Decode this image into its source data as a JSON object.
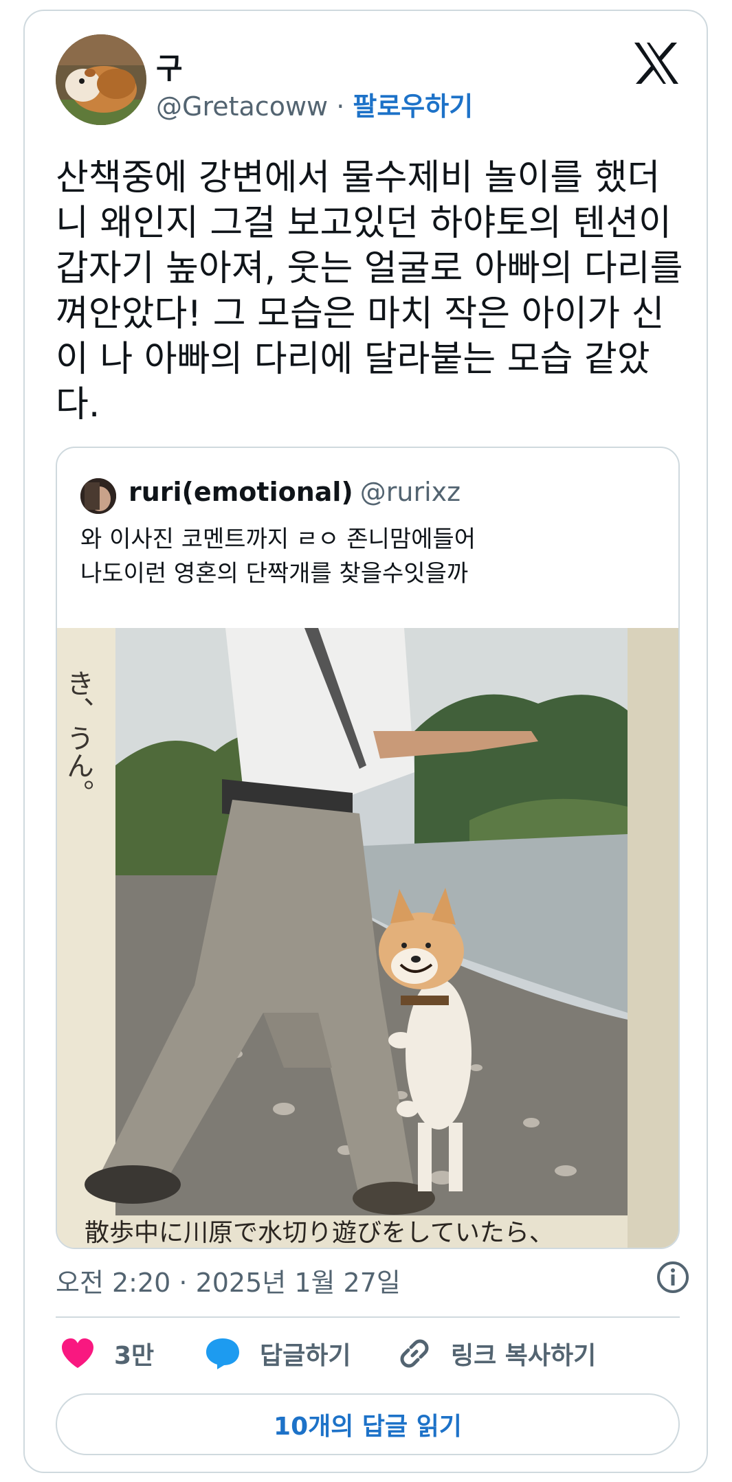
{
  "author": {
    "name": "구",
    "handle": "@Gretacoww",
    "separator": " · ",
    "follow_label": "팔로우하기"
  },
  "tweet": {
    "text": "산책중에 강변에서 물수제비 놀이를 했더니 왜인지 그걸 보고있던 하야토의 텐션이 갑자기 높아져, 웃는 얼굴로 아빠의 다리를 껴안았다! 그 모습은 마치 작은 아이가 신이 나 아빠의 다리에 달라붙는 모습 같았다."
  },
  "quoted": {
    "name": "ruri(emotional)",
    "handle": "@rurixz",
    "text_line1": "와 이사진 코멘트까지 ㄹㅇ 존니맘에들어",
    "text_line2": "나도이런 영혼의 단짝개를 찾을수잇을까",
    "photo_caption": "散歩中に川原で水切り遊びをしていたら、",
    "photo_side_text": "き、うん。"
  },
  "meta": {
    "timestamp": "오전 2:20 · 2025년 1월 27일"
  },
  "actions": {
    "likes": "3만",
    "reply_label": "답글하기",
    "copy_link_label": "링크 복사하기",
    "read_replies_label": "10개의 답글 읽기"
  },
  "colors": {
    "like": "#f91880",
    "reply": "#1d9bf0",
    "link_blue": "#1d72c8",
    "secondary_text": "#536471",
    "border": "#cfd9de"
  },
  "icons": [
    "x-logo-icon",
    "info-icon",
    "heart-icon",
    "reply-bubble-icon",
    "link-icon"
  ]
}
